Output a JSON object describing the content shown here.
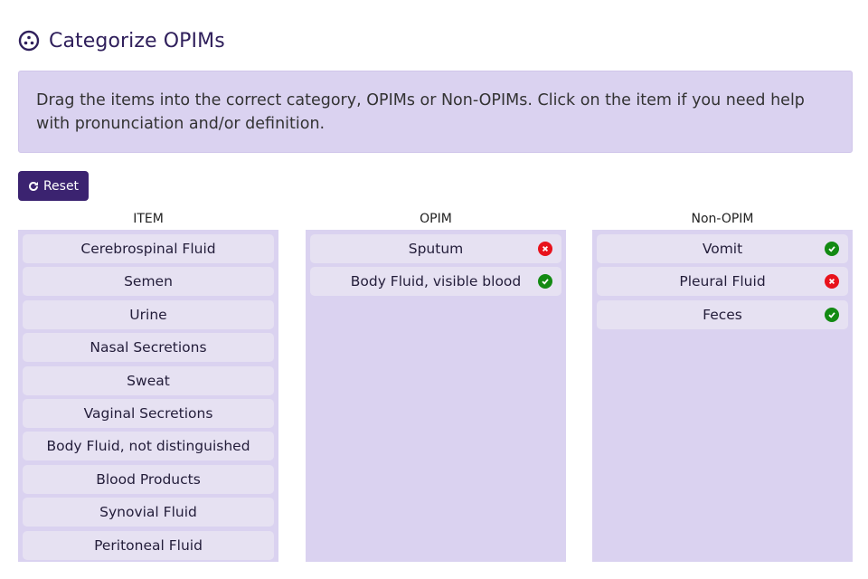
{
  "header": {
    "title": "Categorize OPIMs",
    "icon": "puzzle-molecule-icon"
  },
  "instructions": "Drag the items into the correct category, OPIMs or Non-OPIMs. Click on the item if you need help with pronunciation and/or definition.",
  "toolbar": {
    "reset_label": "Reset",
    "reset_icon": "refresh-icon"
  },
  "colors": {
    "accent": "#3b2370",
    "panel": "#dad2f0",
    "card": "#e6e1f2",
    "correct": "#138a13",
    "wrong": "#e8121c"
  },
  "columns": [
    {
      "header": "ITEM",
      "items": [
        {
          "label": "Cerebrospinal Fluid"
        },
        {
          "label": "Semen"
        },
        {
          "label": "Urine"
        },
        {
          "label": "Nasal Secretions"
        },
        {
          "label": "Sweat"
        },
        {
          "label": "Vaginal Secretions"
        },
        {
          "label": "Body Fluid, not distinguished"
        },
        {
          "label": "Blood Products"
        },
        {
          "label": "Synovial Fluid"
        },
        {
          "label": "Peritoneal Fluid"
        }
      ]
    },
    {
      "header": "OPIM",
      "items": [
        {
          "label": "Sputum",
          "status": "wrong"
        },
        {
          "label": "Body Fluid, visible blood",
          "status": "correct"
        }
      ]
    },
    {
      "header": "Non-OPIM",
      "items": [
        {
          "label": "Vomit",
          "status": "correct"
        },
        {
          "label": "Pleural Fluid",
          "status": "wrong"
        },
        {
          "label": "Feces",
          "status": "correct"
        }
      ]
    }
  ]
}
